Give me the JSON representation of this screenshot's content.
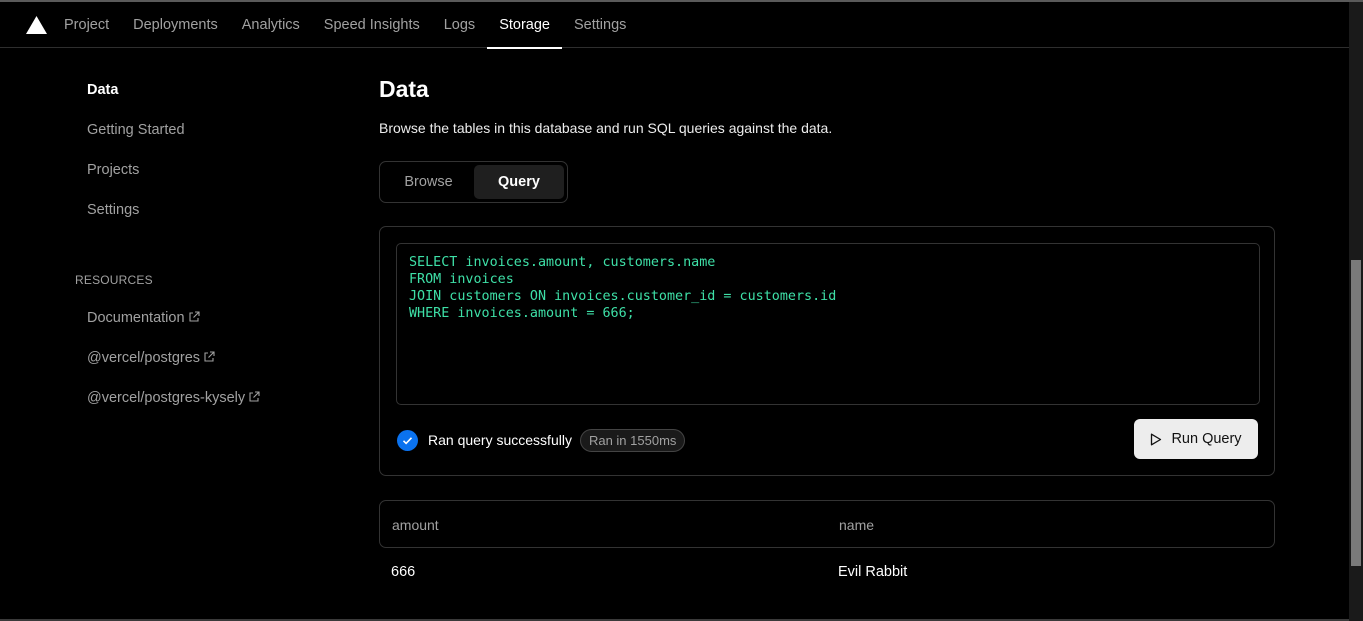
{
  "nav": {
    "tabs": [
      "Project",
      "Deployments",
      "Analytics",
      "Speed Insights",
      "Logs",
      "Storage",
      "Settings"
    ],
    "active": "Storage"
  },
  "sidebar": {
    "items": [
      "Data",
      "Getting Started",
      "Projects",
      "Settings"
    ],
    "resources_heading": "RESOURCES",
    "resources": [
      "Documentation",
      "@vercel/postgres",
      "@vercel/postgres-kysely"
    ]
  },
  "main": {
    "title": "Data",
    "description": "Browse the tables in this database and run SQL queries against the data.",
    "tabs": {
      "browse": "Browse",
      "query": "Query"
    },
    "query_text": "SELECT invoices.amount, customers.name\nFROM invoices\nJOIN customers ON invoices.customer_id = customers.id\nWHERE invoices.amount = 666;",
    "status": "Ran query successfully",
    "timing": "Ran in 1550ms",
    "run_label": "Run Query"
  },
  "results": {
    "columns": [
      "amount",
      "name"
    ],
    "rows": [
      [
        "666",
        "Evil Rabbit"
      ]
    ]
  },
  "colors": {
    "background": "#000000",
    "accent_blue": "#0a72ef",
    "sql_text": "#3ee0a7"
  }
}
